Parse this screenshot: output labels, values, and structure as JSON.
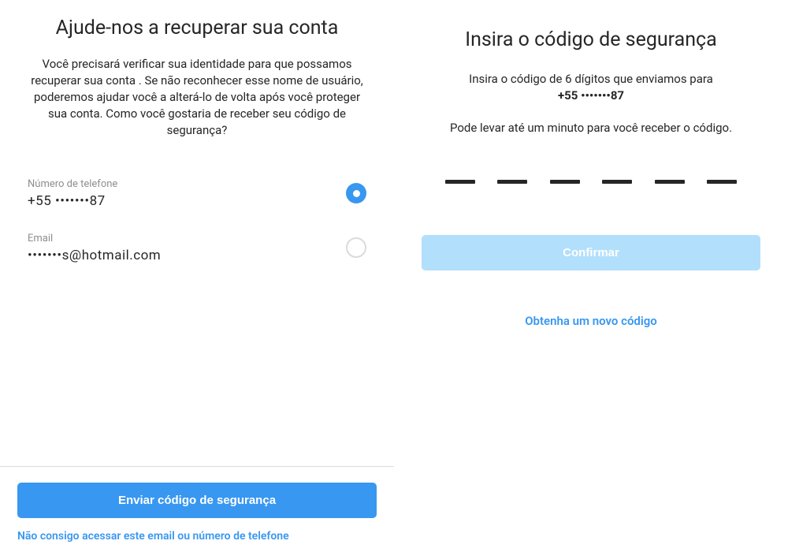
{
  "left": {
    "title": "Ajude-nos a recuperar sua conta",
    "description": "Você precisará verificar sua identidade para que possamos recuperar sua conta . Se não reconhecer esse nome de usuário, poderemos ajudar você a alterá-lo de volta após você proteger sua conta. Como você gostaria de receber seu código de segurança?",
    "phone_label": "Número de telefone",
    "phone_value": "+55 •••••••87",
    "email_label": "Email",
    "email_value": "•••••••s@hotmail.com",
    "send_button": "Enviar código de segurança",
    "cant_access_link": "Não consigo acessar este email ou número de telefone"
  },
  "right": {
    "title": "Insira o código de segurança",
    "subdesc_prefix": "Insira o código de 6 dígitos que enviamos para",
    "subdesc_phone": "+55 •••••••87",
    "subdesc2": "Pode levar até um minuto para você receber o código.",
    "confirm_button": "Confirmar",
    "new_code_link": "Obtenha um novo código"
  }
}
